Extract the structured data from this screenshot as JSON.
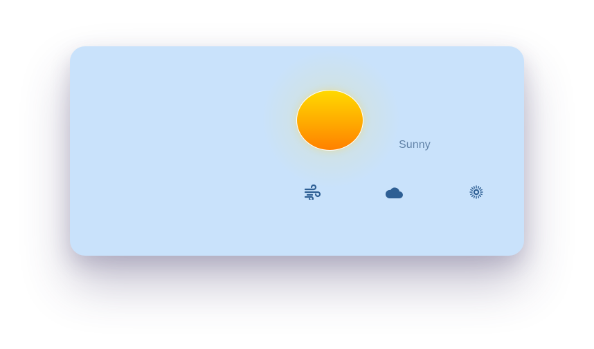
{
  "weather": {
    "condition": "Sunny",
    "icons": [
      "wind-icon",
      "cloud-icon",
      "sun-icon"
    ]
  },
  "colors": {
    "card_background": "#c9e2fb",
    "condition_text": "#6183a8",
    "icon": "#2e5f94",
    "sun_top": "#ffd900",
    "sun_bottom": "#ff8000"
  }
}
